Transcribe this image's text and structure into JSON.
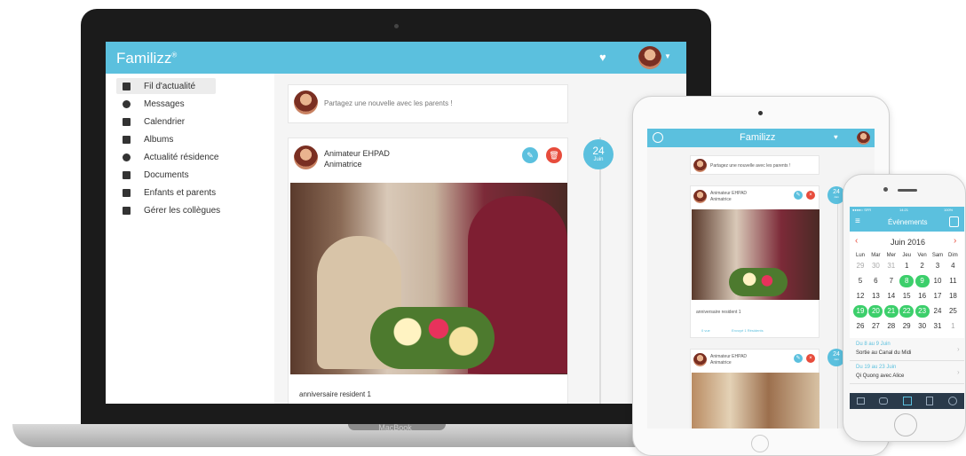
{
  "laptop": {
    "brand": "Familizz",
    "brand_mark": "®",
    "device_label": "MacBook",
    "post_placeholder": "Partagez une nouvelle avec les parents !",
    "sidebar": [
      {
        "label": "Fil d'actualité",
        "icon": "newspaper-icon"
      },
      {
        "label": "Messages",
        "icon": "chat-icon"
      },
      {
        "label": "Calendrier",
        "icon": "calendar-icon"
      },
      {
        "label": "Albums",
        "icon": "image-icon"
      },
      {
        "label": "Actualité résidence",
        "icon": "speech-icon"
      },
      {
        "label": "Documents",
        "icon": "document-icon"
      },
      {
        "label": "Enfants et parents",
        "icon": "family-icon"
      },
      {
        "label": "Gérer les collègues",
        "icon": "users-gear-icon"
      }
    ],
    "post": {
      "author": "Animateur EHPAD",
      "role": "Animatrice",
      "date_day": "24",
      "date_month": "Juin",
      "caption": "anniversaire resident 1"
    }
  },
  "tablet": {
    "brand": "Familizz",
    "post_placeholder": "Partagez une nouvelle avec les parents !",
    "posts": [
      {
        "author": "Animateur EHPAD",
        "role": "Animatrice",
        "date_day": "24",
        "date_month": "Juin",
        "caption": "anniversaire resident 1",
        "views": "0 vue",
        "sent": "Envoyé 1 Résidents"
      },
      {
        "author": "Animateur EHPAD",
        "role": "Animatrice",
        "date_day": "24",
        "date_month": "Juin"
      }
    ]
  },
  "phone": {
    "status_left": "●●●●○ SFR",
    "status_time": "14:21",
    "status_right": "100%",
    "header_title": "Événements",
    "month_title": "Juin 2016",
    "weekdays": [
      "Lun",
      "Mar",
      "Mer",
      "Jeu",
      "Ven",
      "Sam",
      "Dim"
    ],
    "weeks": [
      [
        "29",
        "30",
        "31",
        "1",
        "2",
        "3",
        "4"
      ],
      [
        "5",
        "6",
        "7",
        "8",
        "9",
        "10",
        "11"
      ],
      [
        "12",
        "13",
        "14",
        "15",
        "16",
        "17",
        "18"
      ],
      [
        "19",
        "20",
        "21",
        "22",
        "23",
        "24",
        "25"
      ],
      [
        "26",
        "27",
        "28",
        "29",
        "30",
        "31",
        "1"
      ]
    ],
    "events": [
      {
        "range": "Du 8 au 9 Juin",
        "title": "Sortie au Canal du Midi"
      },
      {
        "range": "Du 19 au 23 Juin",
        "title": "Qi Quong avec Alice"
      }
    ],
    "colors": {
      "accent": "#5bc0de",
      "event_green": "#3ccf6b",
      "delete_red": "#e74c3c"
    }
  }
}
